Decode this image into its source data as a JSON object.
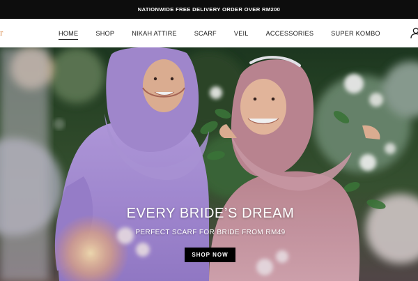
{
  "announcement": "NATIONWIDE FREE DELIVERY ORDER OVER RM200",
  "nav": {
    "items": [
      {
        "label": "HOME",
        "active": true
      },
      {
        "label": "SHOP",
        "active": false
      },
      {
        "label": "NIKAH ATTIRE",
        "active": false
      },
      {
        "label": "SCARF",
        "active": false
      },
      {
        "label": "VEIL",
        "active": false
      },
      {
        "label": "ACCESSORIES",
        "active": false
      },
      {
        "label": "SUPER KOMBO",
        "active": false
      }
    ],
    "account_icon": "user-icon"
  },
  "hero": {
    "title": "EVERY BRIDE’S DREAM",
    "subtitle": "PERFECT SCARF FOR BRIDE FROM RM49",
    "cta_label": "SHOP NOW"
  },
  "colors": {
    "announcement_bg": "#0d0d0d",
    "cta_bg": "#000000",
    "accent_logo": "#d88a4a",
    "lilac_scarf": "#a98fd8",
    "pink_scarf": "#c98a9a"
  }
}
